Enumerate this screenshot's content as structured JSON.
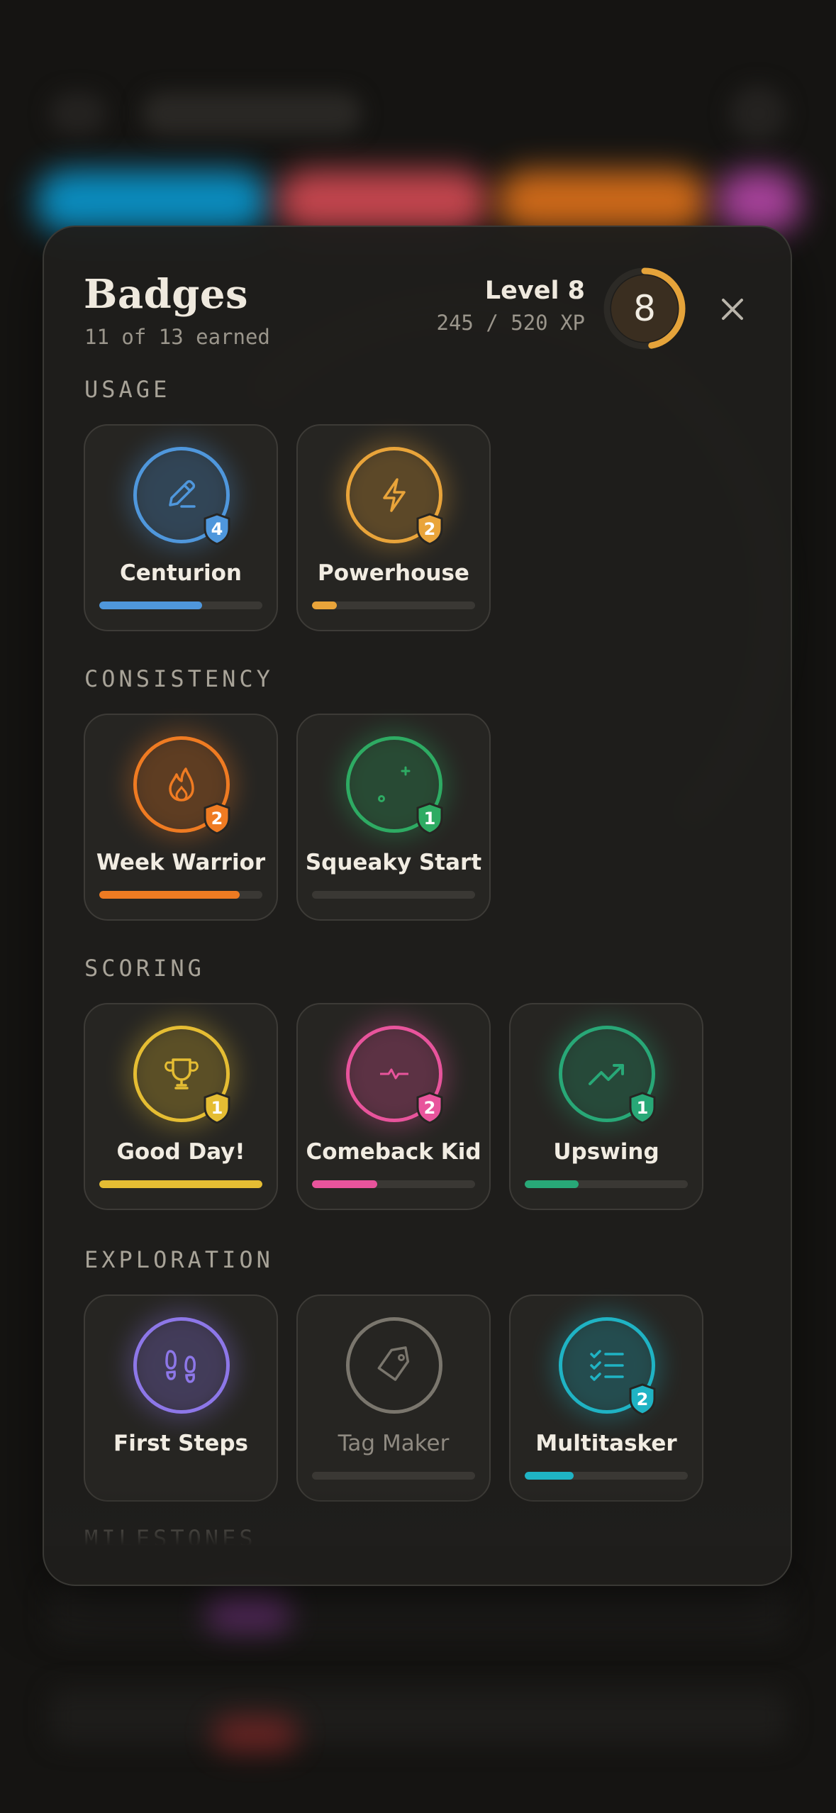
{
  "header": {
    "title": "Badges",
    "subtitle": "11 of 13 earned",
    "level_label": "Level 8",
    "xp_text": "245 / 520 XP",
    "level_number": "8",
    "xp_progress": 0.47,
    "ring_color": "#e5a33a"
  },
  "sections": [
    {
      "title": "USAGE",
      "badges": [
        {
          "name": "Centurion",
          "icon": "pencil-icon",
          "color": "#4f97dc",
          "tier": "4",
          "progress": 0.63,
          "earned": true
        },
        {
          "name": "Powerhouse",
          "icon": "lightning-icon",
          "color": "#e9a43a",
          "tier": "2",
          "progress": 0.15,
          "earned": true
        }
      ]
    },
    {
      "title": "CONSISTENCY",
      "badges": [
        {
          "name": "Week Warrior",
          "icon": "flame-icon",
          "color": "#ef7b22",
          "tier": "2",
          "progress": 0.86,
          "earned": true
        },
        {
          "name": "Squeaky Start",
          "icon": "sparkle-icon",
          "color": "#2eab63",
          "tier": "1",
          "progress": 0,
          "earned": true
        }
      ]
    },
    {
      "title": "SCORING",
      "badges": [
        {
          "name": "Good Day!",
          "icon": "trophy-icon",
          "color": "#e5bd33",
          "tier": "1",
          "progress": 1.0,
          "earned": true
        },
        {
          "name": "Comeback Kid",
          "icon": "heart-pulse-icon",
          "color": "#e8549c",
          "tier": "2",
          "progress": 0.4,
          "earned": true
        },
        {
          "name": "Upswing",
          "icon": "trending-up-icon",
          "color": "#28a877",
          "tier": "1",
          "progress": 0.33,
          "earned": true
        }
      ]
    },
    {
      "title": "EXPLORATION",
      "badges": [
        {
          "name": "First Steps",
          "icon": "footprints-icon",
          "color": "#8d77e8",
          "tier": "",
          "progress": null,
          "earned": true
        },
        {
          "name": "Tag Maker",
          "icon": "tag-icon",
          "color": "#7a766d",
          "tier": "",
          "progress": 0,
          "earned": false
        },
        {
          "name": "Multitasker",
          "icon": "checklist-icon",
          "color": "#1fb3c4",
          "tier": "2",
          "progress": 0.3,
          "earned": true
        }
      ]
    },
    {
      "title": "MILESTONES",
      "badges": []
    }
  ]
}
